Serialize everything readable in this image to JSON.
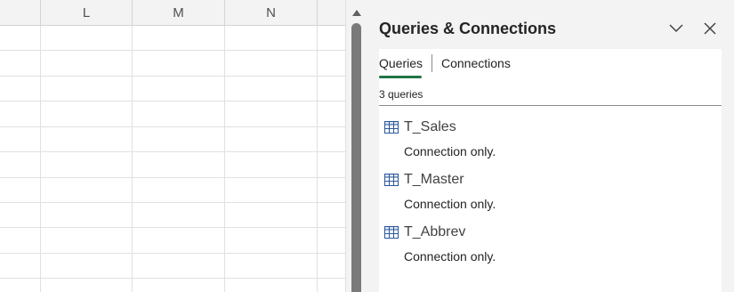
{
  "sheet": {
    "columns": [
      "L",
      "M",
      "N"
    ]
  },
  "pane": {
    "title": "Queries & Connections",
    "tabs": [
      {
        "label": "Queries",
        "active": true
      },
      {
        "label": "Connections",
        "active": false
      }
    ],
    "query_count": "3 queries",
    "queries": [
      {
        "name": "T_Sales",
        "status": "Connection only."
      },
      {
        "name": "T_Master",
        "status": "Connection only."
      },
      {
        "name": "T_Abbrev",
        "status": "Connection only."
      }
    ],
    "icons": {
      "collapse": "chevron-down-icon",
      "close": "close-icon",
      "query": "table-icon"
    }
  },
  "colors": {
    "accent": "#217346",
    "pane_background": "#f3f3f3",
    "scroll_thumb": "#7a7a7a"
  }
}
